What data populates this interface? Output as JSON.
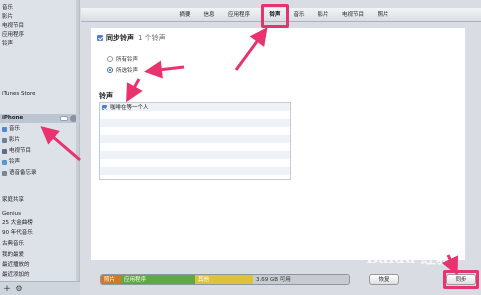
{
  "sidebar": {
    "top_items": [
      {
        "label": "音乐"
      },
      {
        "label": "影片"
      },
      {
        "label": "电视节目"
      },
      {
        "label": "应用程序"
      },
      {
        "label": "铃声"
      }
    ],
    "store_label": "iTunes Store",
    "device": {
      "label": "iPhone"
    },
    "device_items": [
      {
        "label": "音乐"
      },
      {
        "label": "影片"
      },
      {
        "label": "电视节目"
      },
      {
        "label": "铃声"
      },
      {
        "label": "语音备忘录"
      }
    ],
    "shared_label": "家庭共享",
    "playlists": [
      {
        "label": "Genius"
      },
      {
        "label": "25 大金曲榜"
      },
      {
        "label": "90 年代音乐"
      },
      {
        "label": "古典音乐"
      },
      {
        "label": "我的最爱"
      },
      {
        "label": "最近播放的"
      },
      {
        "label": "最近添加的"
      }
    ],
    "add_icon": "+",
    "gear_icon": "⚙"
  },
  "tabs": [
    {
      "label": "摘要"
    },
    {
      "label": "信息"
    },
    {
      "label": "应用程序"
    },
    {
      "label": "铃声",
      "selected": true
    },
    {
      "label": "音乐"
    },
    {
      "label": "影片"
    },
    {
      "label": "电视节目"
    },
    {
      "label": "照片"
    }
  ],
  "sync": {
    "label": "同步铃声",
    "count": "1 个铃声",
    "checked": true
  },
  "options": [
    {
      "label": "所有铃声",
      "selected": false
    },
    {
      "label": "所选铃声",
      "selected": true
    }
  ],
  "ringtones": {
    "title": "铃声",
    "items": [
      {
        "name": "咖啡在等一个人",
        "checked": true
      }
    ]
  },
  "capacity": {
    "photos_label": "照片",
    "apps_label": "应用程序",
    "other_label": "其他",
    "free_label": "3.69 GB 可用"
  },
  "buttons": {
    "restore": "恢复",
    "sync": "同步"
  },
  "watermark": "Baidu 经验",
  "colors": {
    "highlight": "#e8336f",
    "photos": "#d07b2a",
    "apps": "#5fa843",
    "other": "#e0c23a"
  }
}
